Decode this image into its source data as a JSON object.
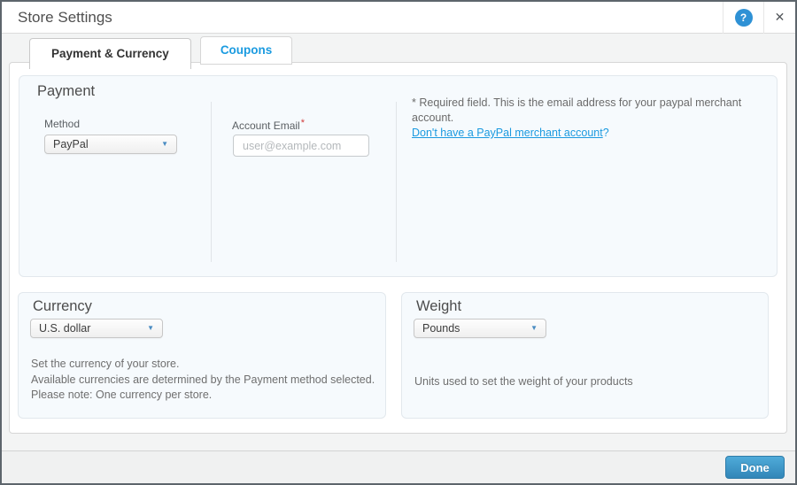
{
  "header": {
    "title": "Store Settings"
  },
  "icons": {
    "help": "?",
    "close": "✕",
    "dropdown_caret": "▼"
  },
  "tabs": {
    "payment_currency": "Payment & Currency",
    "coupons": "Coupons"
  },
  "payment": {
    "heading": "Payment",
    "method_label": "Method",
    "method_value": "PayPal",
    "email_label": "Account Email",
    "required_mark": "*",
    "email_placeholder": "user@example.com",
    "note_line1": "* Required field. This is the email address for your paypal merchant",
    "note_line2": "account.",
    "link_text": "Don't have a PayPal merchant account",
    "link_suffix": "?"
  },
  "currency": {
    "heading": "Currency",
    "value": "U.S. dollar",
    "desc_line1": "Set the currency of your store.",
    "desc_line2": "Available currencies are determined by the Payment method selected.",
    "desc_line3": "Please note: One currency per store."
  },
  "weight": {
    "heading": "Weight",
    "value": "Pounds",
    "desc": "Units used to set the weight of your products"
  },
  "footer": {
    "done_label": "Done"
  },
  "colors": {
    "accent_blue": "#1b9be0",
    "button_blue": "#3286b8",
    "panel_bg": "#f6fafd",
    "required_red": "#d23c3c"
  }
}
